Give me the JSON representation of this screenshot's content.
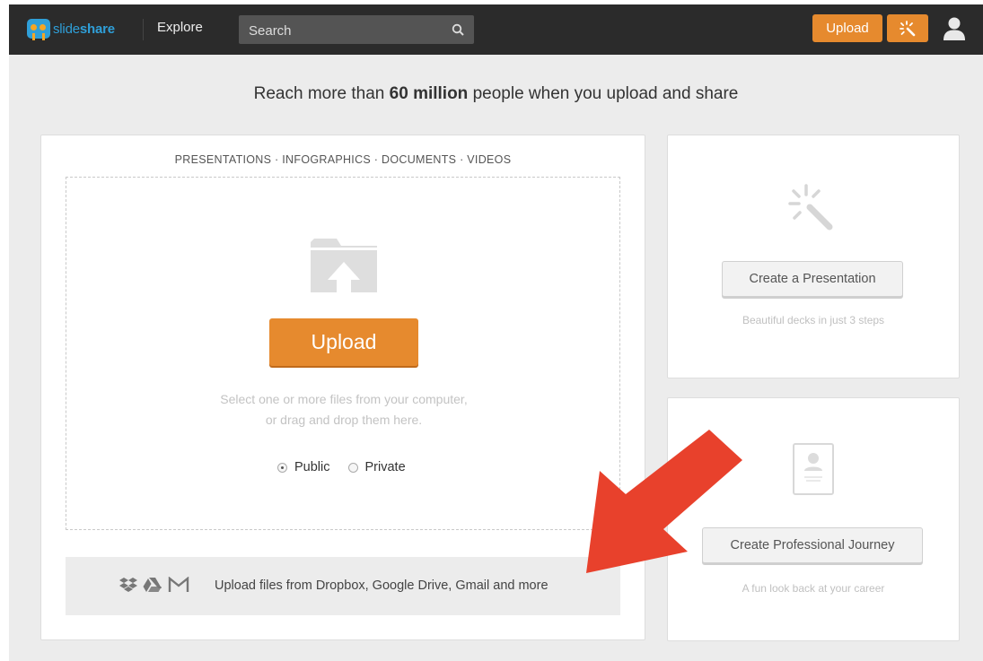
{
  "header": {
    "logo_text_light": "slide",
    "logo_text_bold": "share",
    "explore_label": "Explore",
    "search_placeholder": "Search",
    "upload_label": "Upload"
  },
  "headline": {
    "prefix": "Reach more than ",
    "highlight": "60 million",
    "suffix": " people when you upload and share"
  },
  "upload_panel": {
    "file_types": "PRESENTATIONS  ·  INFOGRAPHICS  ·  DOCUMENTS  ·  VIDEOS",
    "upload_button": "Upload",
    "hint_line1": "Select one or more files from your computer,",
    "hint_line2": "or drag and drop them here.",
    "privacy": {
      "public_label": "Public",
      "private_label": "Private",
      "selected": "Public"
    },
    "cloud_text": "Upload files from Dropbox, Google Drive, Gmail and more"
  },
  "cards": {
    "presentation": {
      "button": "Create a Presentation",
      "subtitle": "Beautiful decks in just 3 steps"
    },
    "journey": {
      "button": "Create Professional Journey",
      "subtitle": "A fun look back at your career"
    }
  },
  "colors": {
    "topbar": "#2b2b2b",
    "accent_orange": "#e68a2e",
    "brand_blue": "#2f9fd8",
    "annotation_arrow": "#e8412c"
  }
}
